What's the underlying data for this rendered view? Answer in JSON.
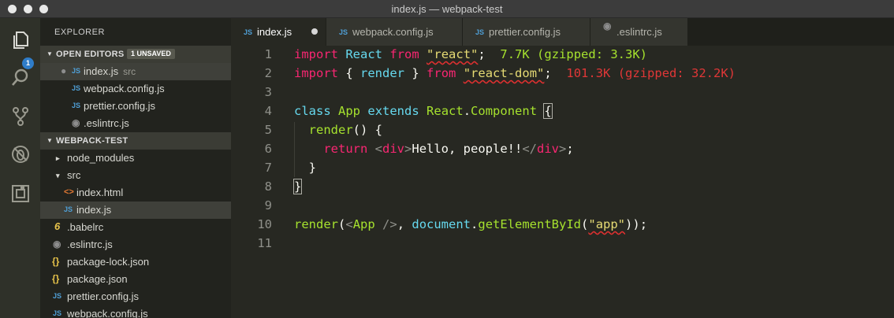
{
  "window": {
    "title": "index.js — webpack-test"
  },
  "activity_bar": {
    "badge_count": "1",
    "icons": [
      "files-icon",
      "search-icon",
      "source-control-icon",
      "debug-icon",
      "extensions-icon"
    ]
  },
  "sidebar": {
    "title": "EXPLORER",
    "open_editors": {
      "label": "OPEN EDITORS",
      "badge": "1 UNSAVED",
      "items": [
        {
          "name": "index.js",
          "sub": "src",
          "icon": "JS"
        },
        {
          "name": "webpack.config.js",
          "icon": "JS"
        },
        {
          "name": "prettier.config.js",
          "icon": "JS"
        },
        {
          "name": ".eslintrc.js",
          "icon": "◉"
        }
      ]
    },
    "project": {
      "label": "WEBPACK-TEST",
      "items": [
        {
          "name": "node_modules",
          "icon": "▸"
        },
        {
          "name": "src",
          "icon": "▾"
        },
        {
          "name": "index.html",
          "icon": "<>"
        },
        {
          "name": "index.js",
          "icon": "JS"
        },
        {
          "name": ".babelrc",
          "icon": "6"
        },
        {
          "name": ".eslintrc.js",
          "icon": "◉"
        },
        {
          "name": "package-lock.json",
          "icon": "{}"
        },
        {
          "name": "package.json",
          "icon": "{}"
        },
        {
          "name": "prettier.config.js",
          "icon": "JS"
        },
        {
          "name": "webpack.config.js",
          "icon": "JS"
        }
      ]
    }
  },
  "tabs": [
    {
      "label": "index.js",
      "icon": "JS",
      "active": true,
      "unsaved": true
    },
    {
      "label": "webpack.config.js",
      "icon": "JS"
    },
    {
      "label": "prettier.config.js",
      "icon": "JS"
    },
    {
      "label": ".eslintrc.js",
      "icon": "◉"
    }
  ],
  "editor": {
    "line_numbers": [
      "1",
      "2",
      "3",
      "4",
      "5",
      "6",
      "7",
      "8",
      "9",
      "10",
      "11"
    ],
    "l1": {
      "import": "import",
      "react": "React",
      "from": "from",
      "str": "\"react\"",
      "semi": ";",
      "cost": "7.7K (gzipped: 3.3K)"
    },
    "l2": {
      "import": "import",
      "open": "{ ",
      "render": "render",
      "close": " }",
      "from": "from",
      "str": "\"react-dom\"",
      "semi": ";",
      "cost": "101.3K (gzipped: 32.2K)"
    },
    "l4": {
      "class": "class",
      "app": "App",
      "extends": "extends",
      "react": "React",
      "dot": ".",
      "component": "Component",
      "brace": "{"
    },
    "l5": {
      "render": "render",
      "rest": "() {"
    },
    "l6": {
      "ret": "return",
      "lt": "<",
      "tag_open": "div",
      "gt": ">",
      "text": "Hello, people!!",
      "close_lt": "</",
      "tag_close": "div",
      "close_gt": ">",
      "semi": ";"
    },
    "l7": {
      "brace": "}"
    },
    "l8": {
      "brace": "}"
    },
    "l10": {
      "render": "render",
      "p1": "(",
      "lt": "<",
      "app": "App",
      "selfclose": " />",
      "comma": ", ",
      "doc": "document",
      "dot": ".",
      "method": "getElementById",
      "p2": "(",
      "str": "\"app\"",
      "end": "));"
    }
  }
}
